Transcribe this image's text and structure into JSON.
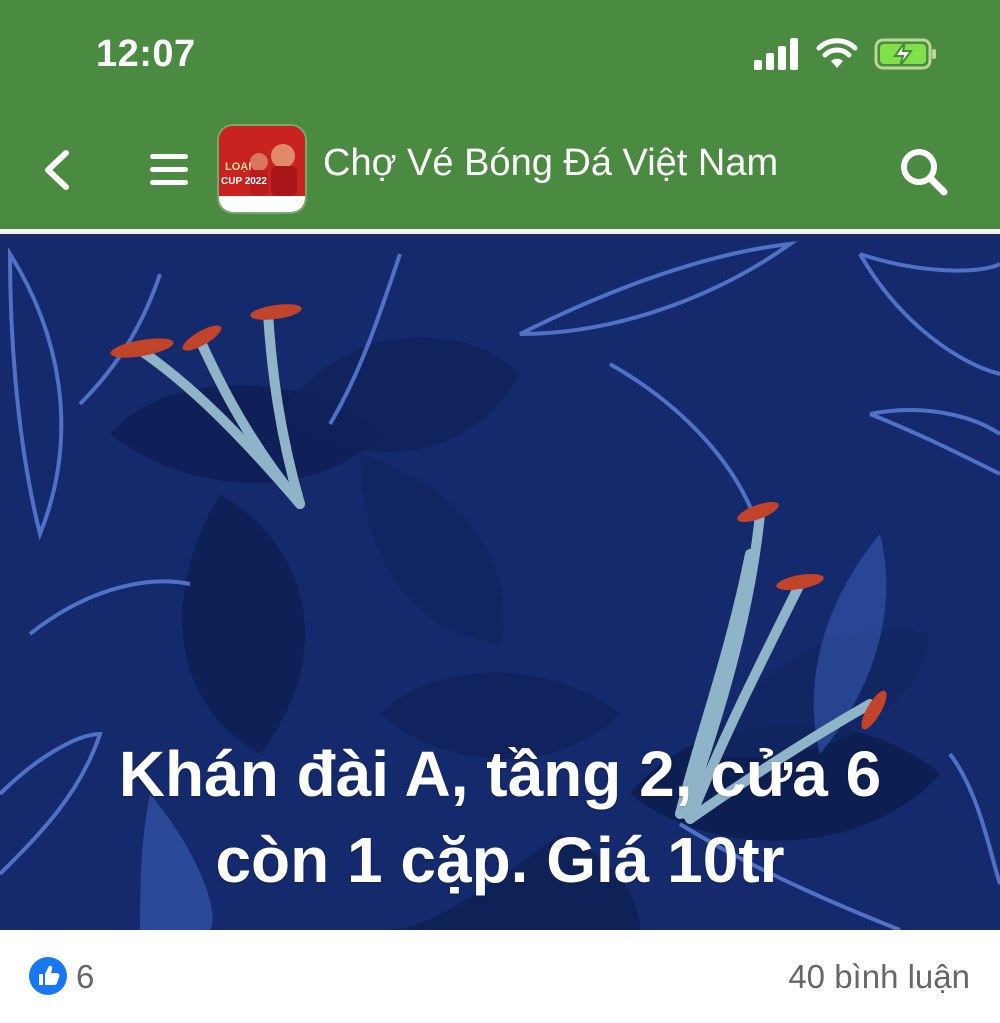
{
  "status_bar": {
    "time": "12:07",
    "icons": [
      "signal-icon",
      "wifi-icon",
      "battery-charging-icon"
    ]
  },
  "header": {
    "back_icon": "chevron-left-icon",
    "menu_icon": "hamburger-menu-icon",
    "group_avatar_text_1": "LOẠI",
    "group_avatar_text_2": "CUP 2022",
    "title": "Chợ Vé Bóng Đá Việt Nam",
    "search_icon": "search-icon",
    "colors": {
      "bar": "#4a8a41",
      "text": "#ffffff"
    }
  },
  "post": {
    "text_line_1": "Khán đài A, tầng 2, cửa 6",
    "text_line_2": "còn 1 cặp. Giá 10tr",
    "background_color": "#142a6c"
  },
  "footer": {
    "like_icon": "like-icon",
    "like_count": "6",
    "comment_count": "40 bình luận",
    "colors": {
      "like": "#1877f2",
      "meta_text": "#65676b"
    }
  }
}
